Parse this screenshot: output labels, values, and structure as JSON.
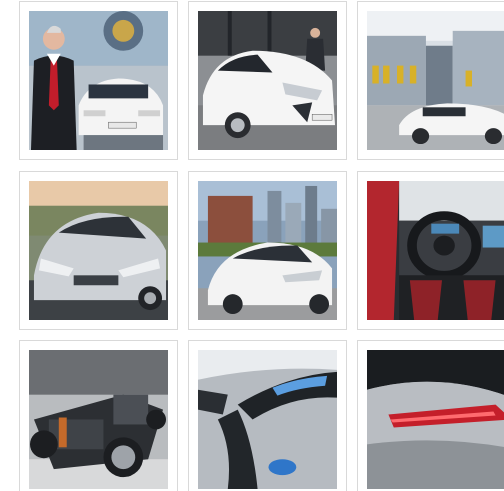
{
  "gallery": {
    "items": [
      {
        "icon": "photo-executive-with-car"
      },
      {
        "icon": "photo-white-car-front-street"
      },
      {
        "icon": "photo-white-car-city-buildings"
      },
      {
        "icon": "photo-silver-car-front-road"
      },
      {
        "icon": "photo-white-car-skyline"
      },
      {
        "icon": "photo-car-interior-steering-wheel"
      },
      {
        "icon": "photo-car-chassis-drivetrain"
      },
      {
        "icon": "photo-headlight-closeup"
      },
      {
        "icon": "photo-taillight-closeup"
      }
    ]
  },
  "colors": {
    "border": "#d9d9d9",
    "background": "#ffffff",
    "car_white": "#f2f2f2",
    "car_silver": "#c8ccd0"
  }
}
